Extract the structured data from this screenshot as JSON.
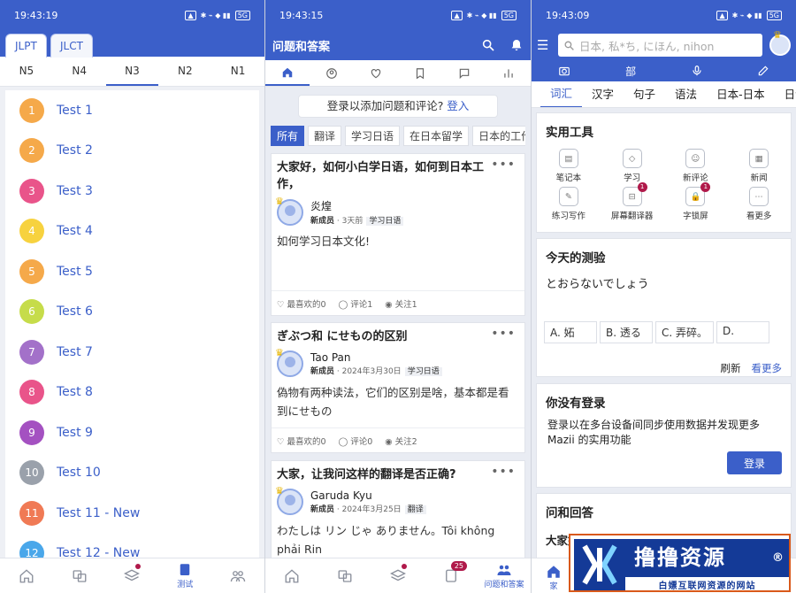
{
  "colors": {
    "primary": "#3b5fc9",
    "badge": "#b0194a"
  },
  "phone1": {
    "status_time": "19:43:19",
    "tabs": [
      "JLPT",
      "JLCT"
    ],
    "levels": [
      "N5",
      "N4",
      "N3",
      "N2",
      "N1"
    ],
    "active_level": "N3",
    "tests": [
      {
        "num": "1",
        "label": "Test 1",
        "color": "#f5a94a"
      },
      {
        "num": "2",
        "label": "Test 2",
        "color": "#f5a94a"
      },
      {
        "num": "3",
        "label": "Test 3",
        "color": "#e9548a"
      },
      {
        "num": "4",
        "label": "Test 4",
        "color": "#f7d23f"
      },
      {
        "num": "5",
        "label": "Test 5",
        "color": "#f5a94a"
      },
      {
        "num": "6",
        "label": "Test 6",
        "color": "#c6dc4a"
      },
      {
        "num": "7",
        "label": "Test 7",
        "color": "#a371c9"
      },
      {
        "num": "8",
        "label": "Test 8",
        "color": "#e9548a"
      },
      {
        "num": "9",
        "label": "Test 9",
        "color": "#a451c1"
      },
      {
        "num": "10",
        "label": "Test 10",
        "color": "#9aa1ab"
      },
      {
        "num": "11",
        "label": "Test 11 - New",
        "color": "#f07a55"
      },
      {
        "num": "12",
        "label": "Test 12 - New",
        "color": "#4aa7ea"
      }
    ],
    "nav_active_label": "测试"
  },
  "phone2": {
    "status_time": "19:43:15",
    "title": "问题和答案",
    "login_prompt": "登录以添加问题和评论? ",
    "login_link": "登入",
    "chips": [
      "所有",
      "翻译",
      "学习日语",
      "在日本留学",
      "日本的工作"
    ],
    "posts": [
      {
        "title": "大家好，如何小白学日语，如何到日本工作，",
        "author": "炎煌",
        "role": "新成员",
        "meta": " · 3天前",
        "tag": "学习日语",
        "body": "如何学习日本文化!",
        "likes": "最喜欢的0",
        "comments": "评论1",
        "follows": "关注1"
      },
      {
        "title": "ぎぶつ和 にせもの的区别",
        "author": "Tao Pan",
        "role": "新成员",
        "meta": " · 2024年3月30日",
        "tag": "学习日语",
        "body": "偽物有两种读法，它们的区别是啥，基本都是看到にせもの",
        "likes": "最喜欢的0",
        "comments": "评论0",
        "follows": "关注2"
      },
      {
        "title": "大家，让我问这样的翻译是否正确?",
        "author": "Garuda Kyu",
        "role": "新成员",
        "meta": " · 2024年3月25日",
        "tag": "翻译",
        "body": "わたしは リン じゃ ありません。Tôi không phải Rin",
        "likes": "",
        "comments": "",
        "follows": ""
      }
    ],
    "nav_badge": "25",
    "nav_active_label": "问题和答案"
  },
  "phone3": {
    "status_time": "19:43:09",
    "search_placeholder": "日本, 私*ち, にほん, nihon",
    "tools_row_label": "部",
    "categories": [
      "词汇",
      "汉字",
      "句子",
      "语法",
      "日本-日本",
      "日语"
    ],
    "utility_title": "实用工具",
    "utilities": [
      {
        "label": "笔记本",
        "badge": ""
      },
      {
        "label": "学习",
        "badge": ""
      },
      {
        "label": "新评论",
        "badge": ""
      },
      {
        "label": "新闻",
        "badge": ""
      },
      {
        "label": "练习写作",
        "badge": ""
      },
      {
        "label": "屏幕翻译器",
        "badge": "1"
      },
      {
        "label": "字锁屏",
        "badge": "1"
      },
      {
        "label": "看更多",
        "badge": ""
      }
    ],
    "quiz_title": "今天的测验",
    "quiz_question": "とおらないでしょう",
    "quiz_options": [
      "A. 妬",
      "B. 透る",
      "C. 弄碎。",
      "D."
    ],
    "quiz_refresh": "刷新",
    "quiz_more": "看更多",
    "login_title": "你没有登录",
    "login_text": "登录以在多台设备间同步使用数据并发现更多 Mazii 的实用功能",
    "login_button": "登录",
    "qa_title": "问和回答",
    "qa_preview": "大家好，如何小白学日语，如何到日本工作，",
    "nav_home_label": "家"
  },
  "watermark": {
    "title": "撸撸资源",
    "registered": "®",
    "subtitle": "白嫖互联网资源的网站"
  }
}
